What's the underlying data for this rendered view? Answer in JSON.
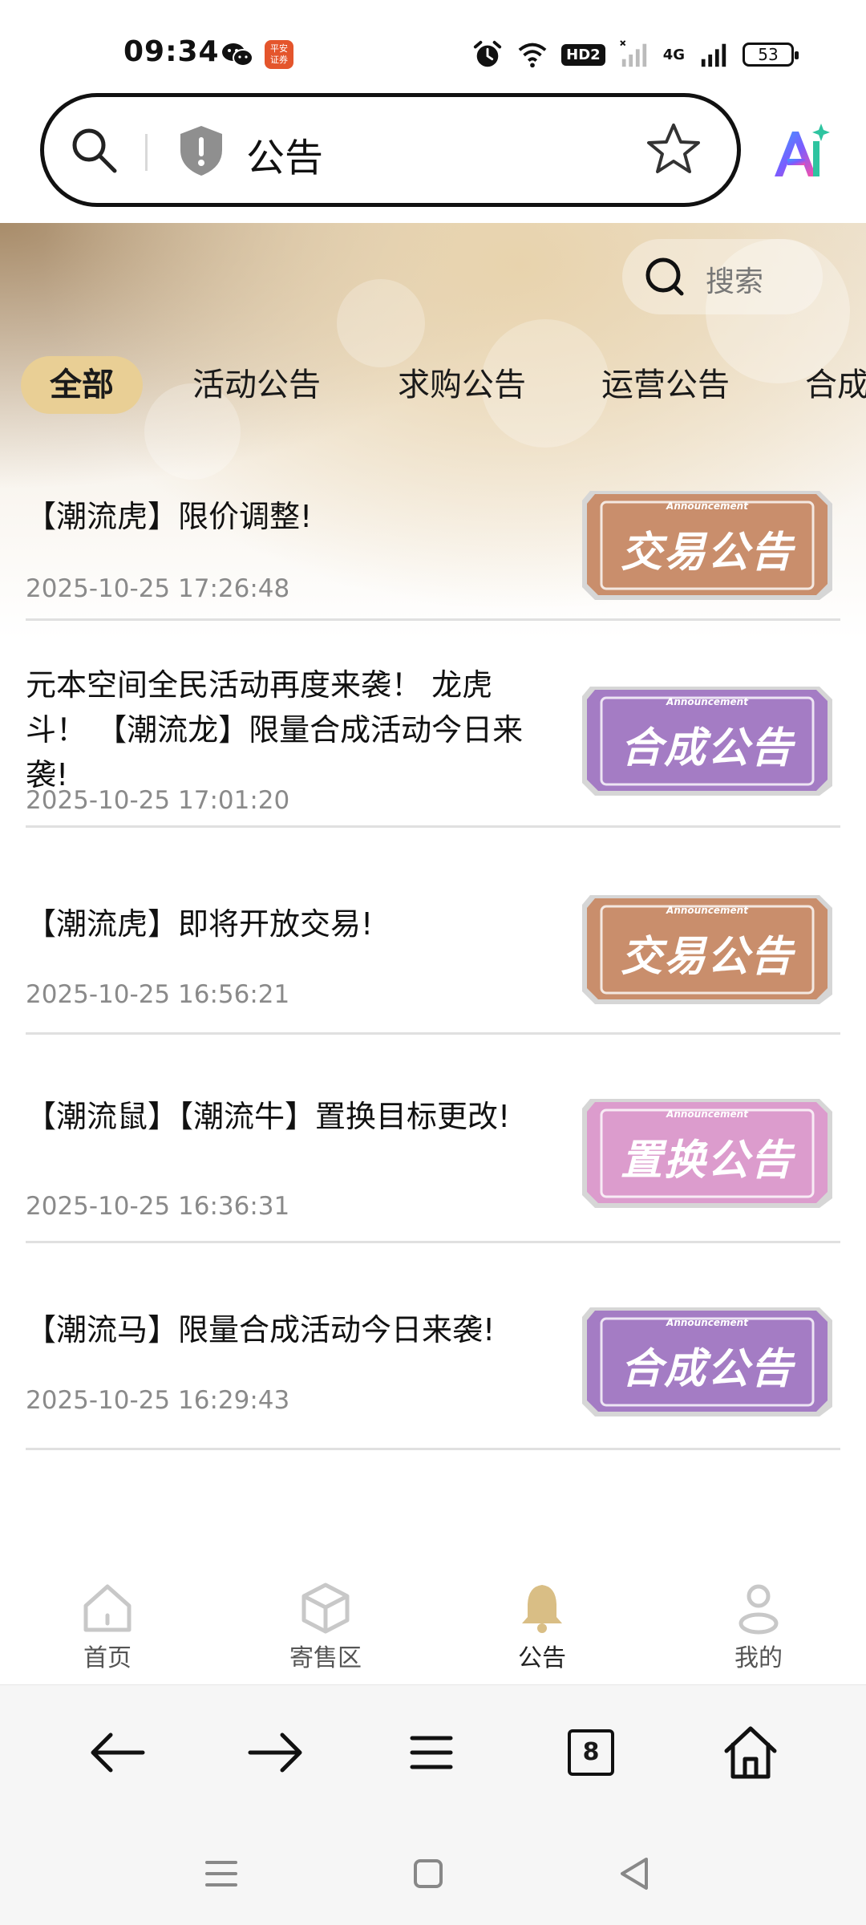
{
  "status_bar": {
    "time": "09:34",
    "app_badge_text": "平安\n证券",
    "hd_label": "HD2",
    "network_label": "4G",
    "battery": "53"
  },
  "address_bar": {
    "text": "公告"
  },
  "search": {
    "label": "搜索"
  },
  "tabs": [
    {
      "label": "全部",
      "active": true
    },
    {
      "label": "活动公告",
      "active": false
    },
    {
      "label": "求购公告",
      "active": false
    },
    {
      "label": "运营公告",
      "active": false
    },
    {
      "label": "合成公告",
      "active": false
    }
  ],
  "announcements": [
    {
      "title": "【潮流虎】限价调整!",
      "date": "2025-10-25 17:26:48",
      "badge": "交易公告",
      "badge_color": "#c98e6c"
    },
    {
      "title": "元本空间全民活动再度来袭！ 龙虎斗！ 【潮流龙】限量合成活动今日来袭!",
      "date": "2025-10-25 17:01:20",
      "badge": "合成公告",
      "badge_color": "#a47cc4"
    },
    {
      "title": "【潮流虎】即将开放交易!",
      "date": "2025-10-25 16:56:21",
      "badge": "交易公告",
      "badge_color": "#c98e6c"
    },
    {
      "title": "【潮流鼠】【潮流牛】置换目标更改!",
      "date": "2025-10-25 16:36:31",
      "badge": "置换公告",
      "badge_color": "#dc9ccd"
    },
    {
      "title": "【潮流马】限量合成活动今日来袭!",
      "date": "2025-10-25 16:29:43",
      "badge": "合成公告",
      "badge_color": "#a47cc4"
    }
  ],
  "badge_subtext": "Announcement",
  "app_nav": [
    {
      "label": "首页",
      "icon": "home-icon",
      "active": false
    },
    {
      "label": "寄售区",
      "icon": "box-icon",
      "active": false
    },
    {
      "label": "公告",
      "icon": "bell-icon",
      "active": true
    },
    {
      "label": "我的",
      "icon": "user-icon",
      "active": false
    }
  ],
  "browser_toolbar": {
    "tab_count": "8"
  },
  "colors": {
    "tab_active_bg": "#e9cf95",
    "bell_active": "#d9be85"
  }
}
